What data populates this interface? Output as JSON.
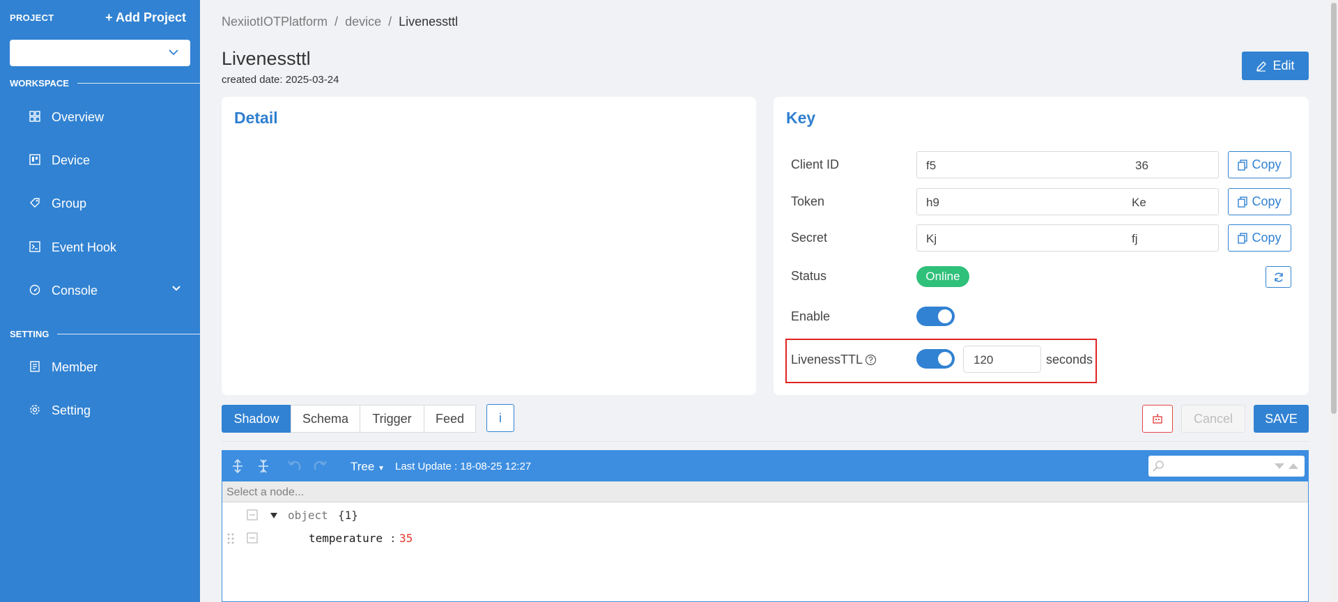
{
  "sidebar": {
    "project_label": "PROJECT",
    "add_project": "+ Add Project",
    "project_value": "",
    "workspace_label": "WORKSPACE",
    "setting_label": "SETTING",
    "workspace_items": [
      {
        "label": "Overview",
        "icon": "grid-icon"
      },
      {
        "label": "Device",
        "icon": "device-icon"
      },
      {
        "label": "Group",
        "icon": "tag-icon"
      },
      {
        "label": "Event Hook",
        "icon": "terminal-icon"
      },
      {
        "label": "Console",
        "icon": "dashboard-icon"
      }
    ],
    "setting_items": [
      {
        "label": "Member",
        "icon": "member-icon"
      },
      {
        "label": "Setting",
        "icon": "gear-icon"
      }
    ]
  },
  "breadcrumb": [
    "NexiiotIOTPlatform",
    "device",
    "Livenessttl"
  ],
  "header": {
    "title": "Livenessttl",
    "created": "created date: 2025-03-24",
    "edit_label": "Edit"
  },
  "detail": {
    "title": "Detail"
  },
  "key": {
    "title": "Key",
    "client_id": {
      "label": "Client ID",
      "value_start": "f5",
      "value_end": "36"
    },
    "token": {
      "label": "Token",
      "value_start": "h9",
      "value_end": "Ke"
    },
    "secret": {
      "label": "Secret",
      "value_start": "Kj",
      "value_end": "fj"
    },
    "copy_label": "Copy",
    "status_label": "Status",
    "status_value": "Online",
    "enable_label": "Enable",
    "enable_on": true,
    "liveness_label": "LivenessTTL",
    "liveness_on": true,
    "liveness_value": "120",
    "liveness_unit": "seconds"
  },
  "tabs": [
    "Shadow",
    "Schema",
    "Trigger",
    "Feed"
  ],
  "actions": {
    "info": "i",
    "cancel": "Cancel",
    "save": "SAVE"
  },
  "editor": {
    "mode": "Tree",
    "last_update": "Last Update : 18-08-25 12:27",
    "navbar": "Select a node...",
    "root_type": "object",
    "root_count": "{1}",
    "field_key": "temperature",
    "field_value": "35"
  },
  "colors": {
    "primary": "#3182d2",
    "online": "#2fc07a",
    "highlight": "#e02424",
    "number_value": "#e0362b"
  }
}
